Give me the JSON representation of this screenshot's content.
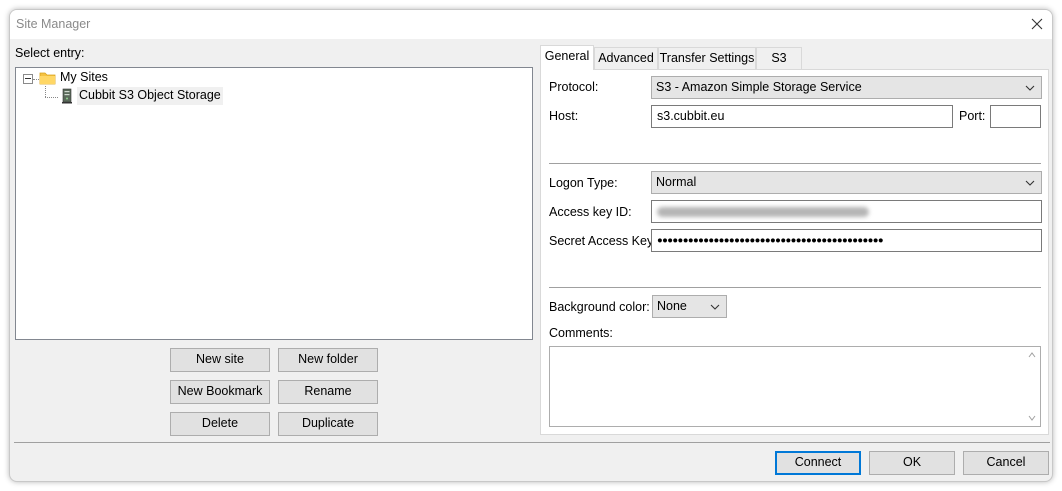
{
  "window": {
    "title": "Site Manager"
  },
  "tree": {
    "label": "Select entry:",
    "root": {
      "label": "My Sites",
      "expander": "⊟"
    },
    "child": {
      "label": "Cubbit S3 Object Storage"
    }
  },
  "left_buttons": {
    "new_site": "New site",
    "new_folder": "New folder",
    "new_bookmark": "New Bookmark",
    "rename": "Rename",
    "delete": "Delete",
    "duplicate": "Duplicate"
  },
  "tabs": [
    "General",
    "Advanced",
    "Transfer Settings",
    "S3"
  ],
  "general": {
    "protocol_label": "Protocol:",
    "protocol_value": "S3 - Amazon Simple Storage Service",
    "host_label": "Host:",
    "host_value": "s3.cubbit.eu",
    "port_label": "Port:",
    "port_value": "",
    "logon_label": "Logon Type:",
    "logon_value": "Normal",
    "access_key_label": "Access key ID:",
    "secret_label": "Secret Access Key:",
    "secret_value": "●●●●●●●●●●●●●●●●●●●●●●●●●●●●●●●●●●●●●●●●●●●●",
    "bg_color_label": "Background color:",
    "bg_color_value": "None",
    "comments_label": "Comments:",
    "comments_value": ""
  },
  "footer": {
    "connect": "Connect",
    "ok": "OK",
    "cancel": "Cancel"
  },
  "colors": {
    "accent": "#0078d7",
    "folder": "#f5c242",
    "selection": "#f0f0f0"
  },
  "icons": {
    "close": "close-icon",
    "folder": "folder-icon",
    "server": "server-icon",
    "chevron": "chevron-down-icon"
  }
}
